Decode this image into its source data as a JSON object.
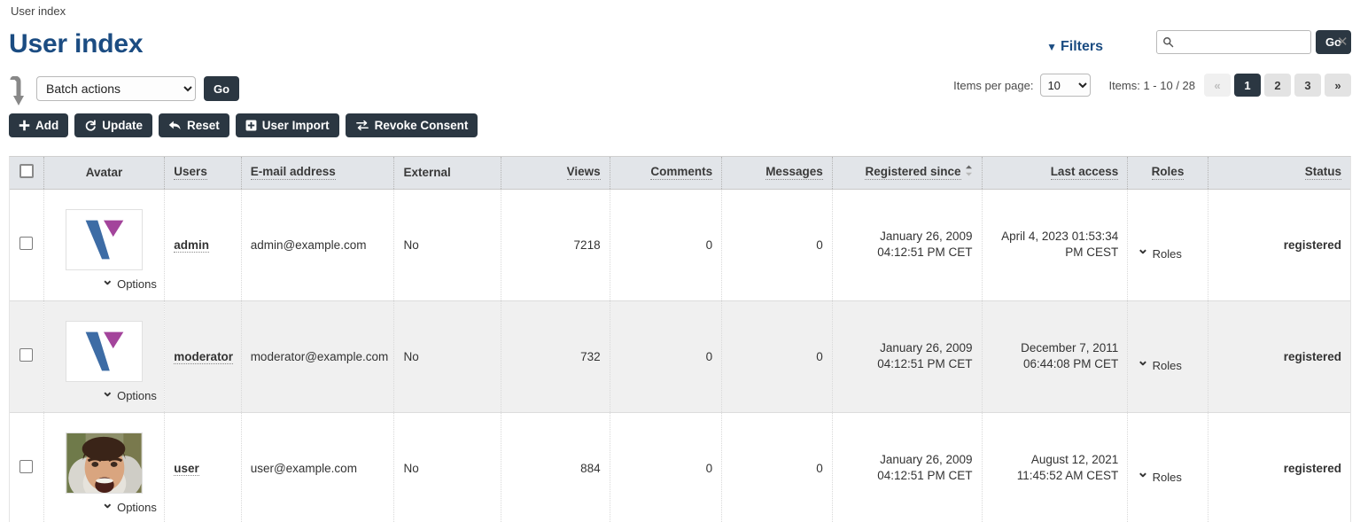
{
  "breadcrumb": "User index",
  "page_title": "User index",
  "filters": {
    "label": "Filters",
    "caret": "▼"
  },
  "search": {
    "value": "",
    "placeholder": "",
    "go_label": "Go",
    "clear": "✕",
    "icon": "search-icon"
  },
  "batch": {
    "selected": "Batch actions",
    "go_label": "Go",
    "options": [
      "Batch actions"
    ]
  },
  "pagination": {
    "items_per_page_label": "Items per page:",
    "items_per_page_value": "10",
    "items_per_page_options": [
      "10"
    ],
    "items_count": "Items: 1 - 10 / 28",
    "first_label": "«",
    "last_label": "»",
    "pages": [
      "1",
      "2",
      "3"
    ],
    "active_page": "1"
  },
  "toolbar": [
    {
      "label": "Add",
      "icon": "plus-icon"
    },
    {
      "label": "Update",
      "icon": "refresh-icon"
    },
    {
      "label": "Reset",
      "icon": "undo-arrow-icon"
    },
    {
      "label": "User Import",
      "icon": "import-box-icon"
    },
    {
      "label": "Revoke Consent",
      "icon": "revoke-icon"
    }
  ],
  "table": {
    "headers": {
      "avatar": "Avatar",
      "users": "Users",
      "email": "E-mail address",
      "external": "External",
      "views": "Views",
      "comments": "Comments",
      "messages": "Messages",
      "registered": "Registered since",
      "last_access": "Last access",
      "roles": "Roles",
      "status": "Status"
    },
    "sort_column": "Registered since",
    "options_label": "Options",
    "roles_label": "Roles",
    "rows": [
      {
        "avatar_type": "logo-v",
        "username": "admin",
        "email": "admin@example.com",
        "external": "No",
        "views": "7218",
        "comments": "0",
        "messages": "0",
        "registered_date": "January 26, 2009",
        "registered_time": "04:12:51 PM CET",
        "last_access_date": "April 4, 2023 01:53:34",
        "last_access_time": "PM CEST",
        "status": "registered"
      },
      {
        "avatar_type": "logo-v",
        "username": "moderator",
        "email": "moderator@example.com",
        "external": "No",
        "views": "732",
        "comments": "0",
        "messages": "0",
        "registered_date": "January 26, 2009",
        "registered_time": "04:12:51 PM CET",
        "last_access_date": "December 7, 2011",
        "last_access_time": "06:44:08 PM CET",
        "status": "registered"
      },
      {
        "avatar_type": "photo-face",
        "username": "user",
        "email": "user@example.com",
        "external": "No",
        "views": "884",
        "comments": "0",
        "messages": "0",
        "registered_date": "January 26, 2009",
        "registered_time": "04:12:51 PM CET",
        "last_access_date": "August 12, 2021",
        "last_access_time": "11:45:52 AM CEST",
        "status": "registered"
      }
    ]
  },
  "colors": {
    "title": "#1b4c82",
    "button": "#2b3742",
    "status": "#3f8f21",
    "header_bg": "#e2e5e9"
  }
}
